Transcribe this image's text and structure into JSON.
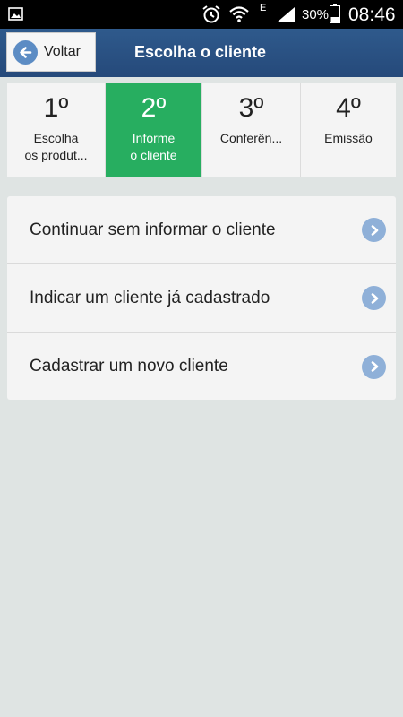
{
  "status_bar": {
    "battery_percent": "30%",
    "time": "08:46",
    "network_label": "E",
    "icons": [
      "gallery-icon",
      "alarm-icon",
      "wifi-icon",
      "signal-icon",
      "battery-icon"
    ]
  },
  "header": {
    "back_label": "Voltar",
    "title": "Escolha o cliente"
  },
  "steps": [
    {
      "number": "1º",
      "label": "Escolha\nos produt...",
      "active": false
    },
    {
      "number": "2º",
      "label": "Informe\no cliente",
      "active": true
    },
    {
      "number": "3º",
      "label": "Conferên...",
      "active": false
    },
    {
      "number": "4º",
      "label": "Emissão",
      "active": false
    }
  ],
  "options": [
    {
      "label": "Continuar sem informar o cliente"
    },
    {
      "label": "Indicar um cliente já cadastrado"
    },
    {
      "label": "Cadastrar um novo cliente"
    }
  ],
  "colors": {
    "header": "#2c5282",
    "active_step": "#27ae60",
    "background": "#dfe4e3",
    "chevron": "#8fb0d8"
  }
}
